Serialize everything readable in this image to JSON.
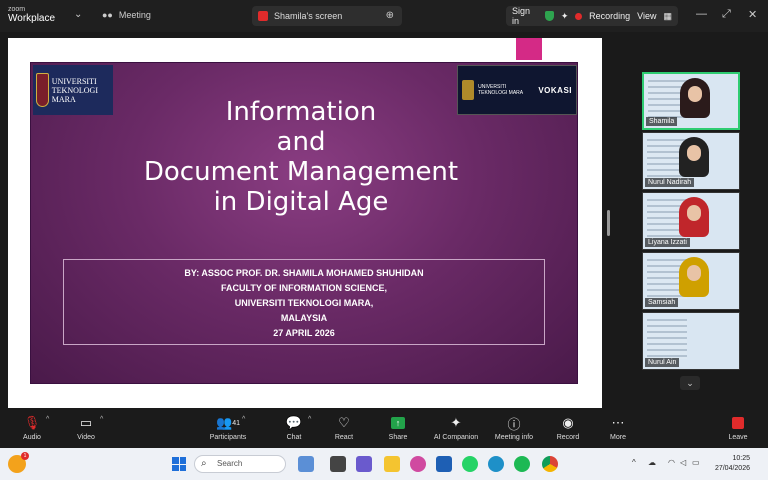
{
  "titlebar": {
    "brand_top": "zoom",
    "brand_bottom": "Workplace",
    "meeting_tab": "Meeting",
    "share_tab": "Shamila's screen",
    "signin": "Sign in",
    "recording": "Recording",
    "view": "View"
  },
  "slide": {
    "title_lines": [
      "Information",
      "and",
      "Document Management",
      "in Digital Age"
    ],
    "logo_left": "UNIVERSITI TEKNOLOGI MARA",
    "logo_right_a": "UNIVERSITI TEKNOLOGI MARA",
    "logo_right_b": "VOKASI",
    "author": "BY: ASSOC PROF. DR. SHAMILA MOHAMED SHUHIDAN",
    "faculty": "FACULTY OF INFORMATION SCIENCE,",
    "university": "UNIVERSITI TEKNOLOGI MARA,",
    "country": "MALAYSIA",
    "date": "27 APRIL 2026"
  },
  "participants": [
    {
      "name": "Shamila",
      "color": "#2b1b1b"
    },
    {
      "name": "Nurul Nadirah",
      "color": "#222"
    },
    {
      "name": "Liyana Izzati",
      "color": "#c0262b"
    },
    {
      "name": "Samsiah",
      "color": "#cfa000"
    },
    {
      "name": "Nurul Ain",
      "color": "#c9d6e2"
    }
  ],
  "toolbar": {
    "audio": "Audio",
    "video": "Video",
    "participants": "Participants",
    "participants_count": "41",
    "chat": "Chat",
    "react": "React",
    "share": "Share",
    "ai": "AI Companion",
    "info": "Meeting info",
    "record": "Record",
    "more": "More",
    "leave": "Leave"
  },
  "taskbar": {
    "search": "Search",
    "weather_badge": "1",
    "time": "10:25",
    "date": "27/04/2026"
  },
  "colors": {
    "accent_green": "#2ea44f",
    "record_red": "#e02b2b",
    "slide_purple": "#6a2a66"
  }
}
